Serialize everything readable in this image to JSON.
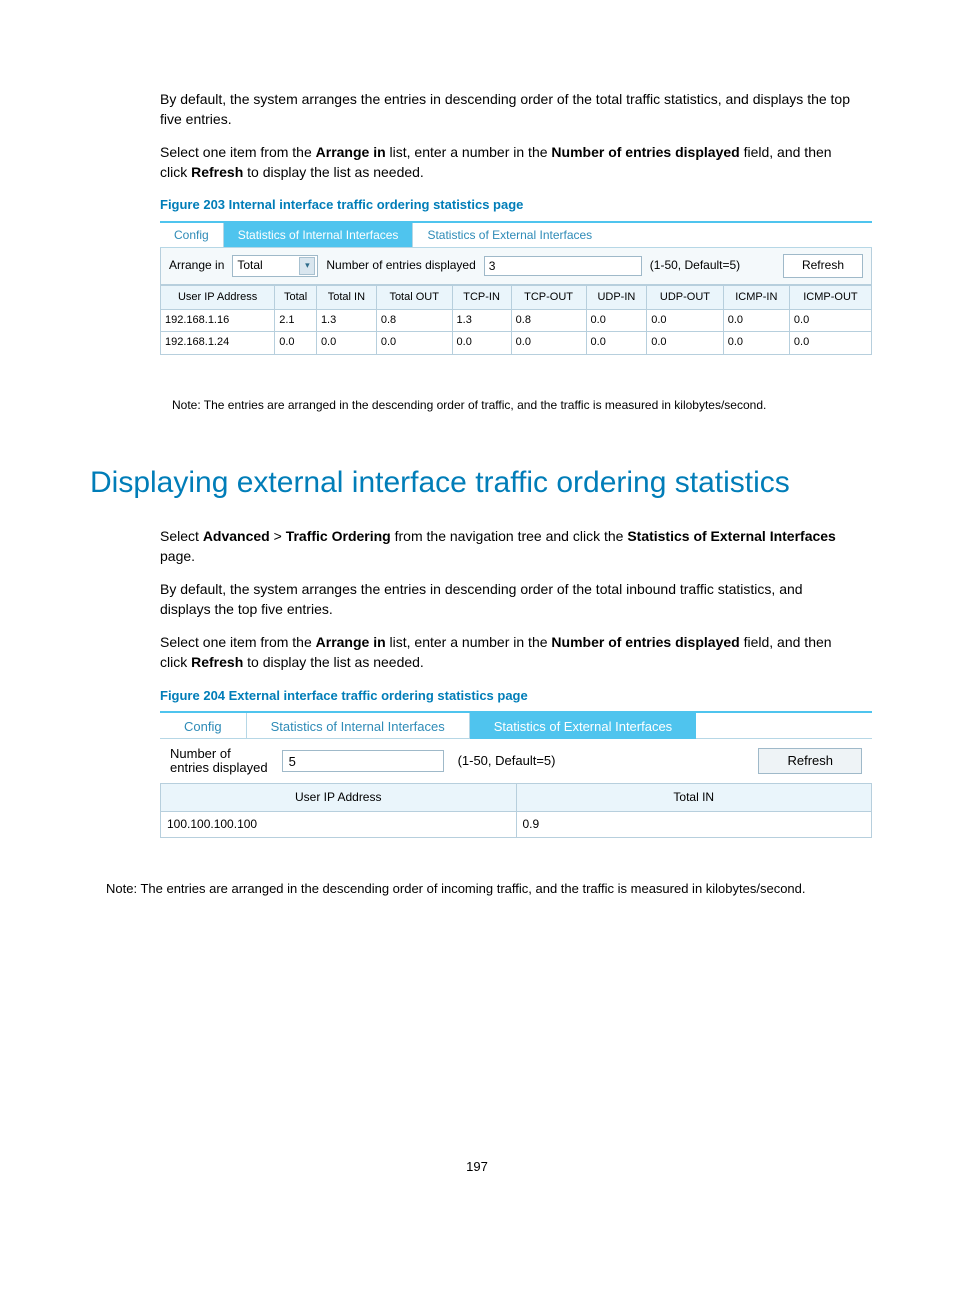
{
  "intro": {
    "p1_a": "By default, the system arranges the entries in descending order of the total traffic statistics, and displays the top five entries.",
    "p2_a": "Select one item from the ",
    "p2_b": "Arrange in",
    "p2_c": " list, enter a number in the ",
    "p2_d": "Number of entries displayed",
    "p2_e": " field, and then click ",
    "p2_f": "Refresh",
    "p2_g": " to display the list as needed."
  },
  "fig203": {
    "caption": "Figure 203 Internal interface traffic ordering statistics page",
    "tabs": {
      "config": "Config",
      "internal": "Statistics of Internal Interfaces",
      "external": "Statistics of External Interfaces"
    },
    "controls": {
      "arrange_label": "Arrange in",
      "arrange_value": "Total",
      "num_label": "Number of entries displayed",
      "num_value": "3",
      "hint": "(1-50, Default=5)",
      "refresh": "Refresh"
    },
    "headers": [
      "User IP Address",
      "Total",
      "Total IN",
      "Total OUT",
      "TCP-IN",
      "TCP-OUT",
      "UDP-IN",
      "UDP-OUT",
      "ICMP-IN",
      "ICMP-OUT"
    ],
    "rows": [
      [
        "192.168.1.16",
        "2.1",
        "1.3",
        "0.8",
        "1.3",
        "0.8",
        "0.0",
        "0.0",
        "0.0",
        "0.0"
      ],
      [
        "192.168.1.24",
        "0.0",
        "0.0",
        "0.0",
        "0.0",
        "0.0",
        "0.0",
        "0.0",
        "0.0",
        "0.0"
      ]
    ],
    "note": "Note: The entries are arranged in the descending order of traffic, and the traffic is measured in kilobytes/second."
  },
  "section_heading": "Displaying external interface traffic ordering statistics",
  "section_body": {
    "p1_a": "Select ",
    "p1_b": "Advanced",
    "p1_c": " > ",
    "p1_d": "Traffic Ordering",
    "p1_e": " from the navigation tree and click the ",
    "p1_f": "Statistics of External Interfaces",
    "p1_g": " page.",
    "p2": "By default, the system arranges the entries in descending order of the total inbound traffic statistics, and displays the top five entries.",
    "p3_a": "Select one item from the ",
    "p3_b": "Arrange in",
    "p3_c": " list, enter a number in the ",
    "p3_d": "Number of entries displayed",
    "p3_e": " field, and then click ",
    "p3_f": "Refresh",
    "p3_g": " to display the list as needed."
  },
  "fig204": {
    "caption": "Figure 204 External interface traffic ordering statistics page",
    "tabs": {
      "config": "Config",
      "internal": "Statistics of Internal Interfaces",
      "external": "Statistics of External Interfaces"
    },
    "controls": {
      "num_label": "Number of\nentries displayed",
      "num_value": "5",
      "hint": "(1-50, Default=5)",
      "refresh": "Refresh"
    },
    "headers": [
      "User IP Address",
      "Total IN"
    ],
    "rows": [
      [
        "100.100.100.100",
        "0.9"
      ]
    ],
    "note": "Note: The entries are arranged in the descending order of incoming traffic, and the traffic is measured in kilobytes/second."
  },
  "page_number": "197"
}
